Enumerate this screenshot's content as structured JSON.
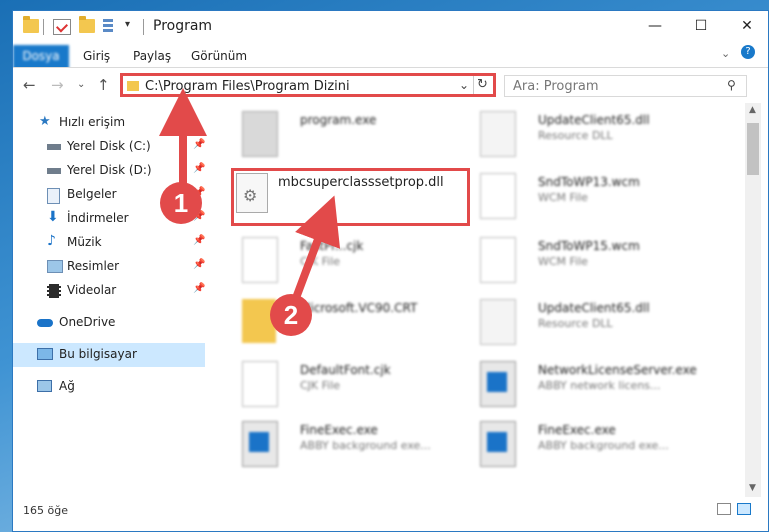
{
  "window": {
    "title": "Program"
  },
  "ribbon": {
    "tabs": [
      "Dosya",
      "Giriş",
      "Paylaş",
      "Görünüm"
    ]
  },
  "address": {
    "path": "C:\\Program Files\\Program Dizini"
  },
  "search": {
    "placeholder": "Ara: Program"
  },
  "sidebar": {
    "items": [
      {
        "label": "Hızlı erişim",
        "icon": "star-icon"
      },
      {
        "label": "Yerel Disk (C:)",
        "icon": "drive-icon"
      },
      {
        "label": "Yerel Disk (D:)",
        "icon": "drive-icon"
      },
      {
        "label": "Belgeler",
        "icon": "documents-icon"
      },
      {
        "label": "İndirmeler",
        "icon": "download-icon"
      },
      {
        "label": "Müzik",
        "icon": "music-icon"
      },
      {
        "label": "Resimler",
        "icon": "pictures-icon"
      },
      {
        "label": "Videolar",
        "icon": "video-icon"
      },
      {
        "label": "OneDrive",
        "icon": "cloud-icon"
      },
      {
        "label": "Bu bilgisayar",
        "icon": "computer-icon"
      },
      {
        "label": "Ağ",
        "icon": "network-icon"
      }
    ]
  },
  "files": [
    {
      "name": "program.exe",
      "type": "",
      "icon": "exe-icon"
    },
    {
      "name": "UpdateClient65.dll",
      "type": "Resource DLL",
      "icon": "dll-icon"
    },
    {
      "name": "mbcsuperclasssetprop.dll",
      "type": "",
      "icon": "dll-gear-icon"
    },
    {
      "name": "SndToWP13.wcm",
      "type": "WCM File",
      "icon": "file-icon"
    },
    {
      "name": "FastPr...cjk",
      "type": "CJK File",
      "icon": "file-icon"
    },
    {
      "name": "SndToWP15.wcm",
      "type": "WCM File",
      "icon": "file-icon"
    },
    {
      "name": "Microsoft.VC90.CRT",
      "type": "",
      "icon": "folder-icon"
    },
    {
      "name": "UpdateClient65.dll",
      "type": "Resource DLL",
      "icon": "dll-icon"
    },
    {
      "name": "DefaultFont.cjk",
      "type": "CJK File",
      "icon": "file-icon"
    },
    {
      "name": "NetworkLicenseServer.exe",
      "type": "ABBY network licens...",
      "icon": "exe-icon"
    },
    {
      "name": "FineExec.exe",
      "type": "ABBY background exe...",
      "icon": "exe-icon"
    },
    {
      "name": "FineExec.exe",
      "type": "ABBY background exe...",
      "icon": "exe-icon"
    }
  ],
  "status": {
    "count": "165 öğe"
  },
  "annotations": {
    "badge1": "1",
    "badge2": "2"
  },
  "colors": {
    "accent": "#1979ca",
    "highlight": "#e24a4a"
  }
}
